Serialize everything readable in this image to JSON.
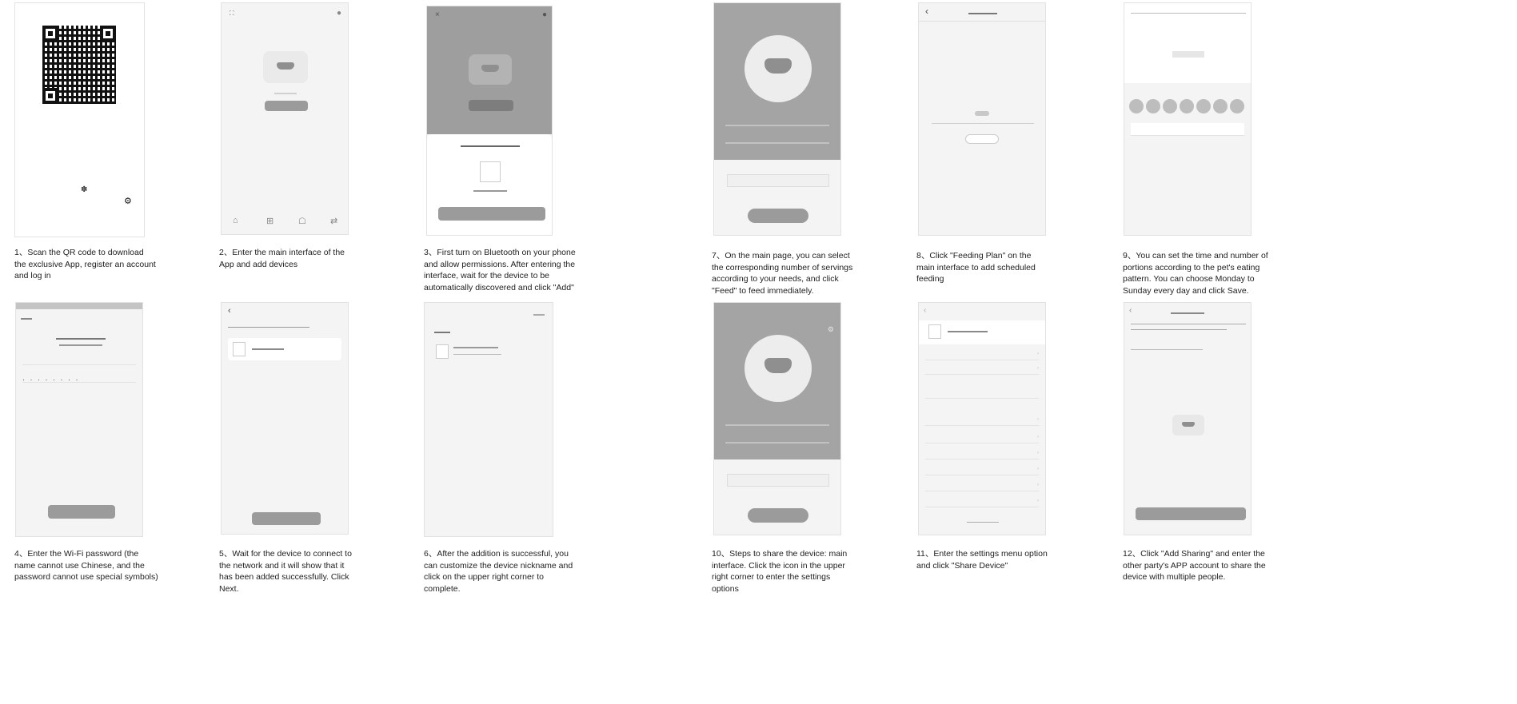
{
  "steps": [
    {
      "id": 1,
      "caption": "1、Scan the QR code to download the exclusive App, register an account and log in"
    },
    {
      "id": 2,
      "caption": "2、Enter the main interface of the App and add devices"
    },
    {
      "id": 3,
      "caption": "3、First turn on Bluetooth on your phone and allow permissions. After entering the interface, wait for the device to be automatically discovered and click \"Add\""
    },
    {
      "id": 4,
      "caption": "4、Enter the Wi-Fi password (the name cannot use Chinese, and the password cannot use special symbols)"
    },
    {
      "id": 5,
      "caption": "5、Wait for the device to connect to the network and it will show that it has been added successfully. Click Next."
    },
    {
      "id": 6,
      "caption": "6、After the addition is successful, you can customize the device nickname and click on the upper right corner to complete."
    },
    {
      "id": 7,
      "caption": "7、On the main page, you can select the corresponding number of servings according to your needs, and click \"Feed\" to feed immediately."
    },
    {
      "id": 8,
      "caption": "8、Click \"Feeding Plan\" on the main interface to add scheduled feeding"
    },
    {
      "id": 9,
      "caption": "9、You can set the time and number of portions according to the pet's eating pattern. You can choose Monday to Sunday every day and click Save."
    },
    {
      "id": 10,
      "caption": "10、Steps to share the device: main interface. Click the icon in the upper right corner to enter the settings options"
    },
    {
      "id": 11,
      "caption": "11、Enter the settings menu option and click \"Share Device\""
    },
    {
      "id": 12,
      "caption": "12、Click \"Add Sharing\" and enter the other party's APP account to share the device with multiple people."
    }
  ],
  "icons": {
    "back": "‹",
    "close": "×",
    "info": "●",
    "chevron": "›",
    "paw": "✽",
    "gear": "⚙"
  }
}
